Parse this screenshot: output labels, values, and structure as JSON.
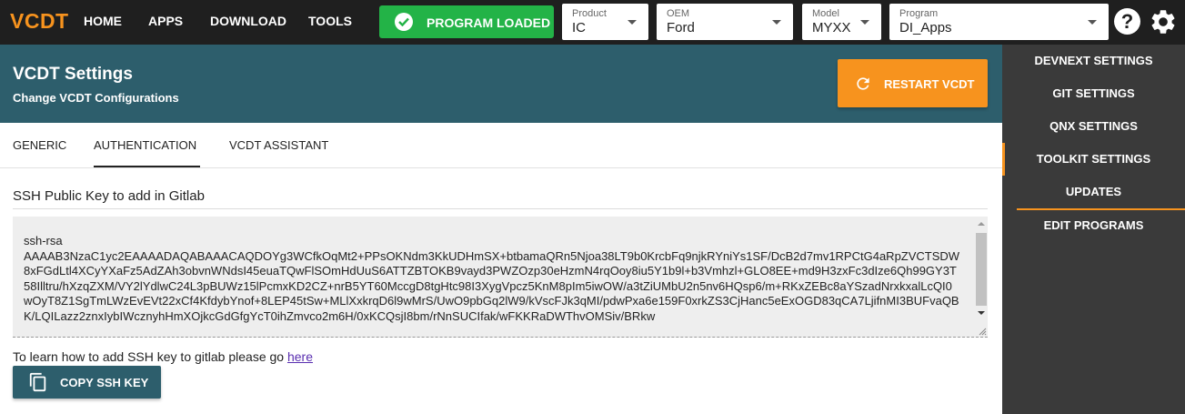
{
  "topbar": {
    "logo": "VCDT",
    "nav": [
      "HOME",
      "APPS",
      "DOWNLOAD",
      "TOOLS"
    ],
    "status_label": "PROGRAM LOADED",
    "status_color": "#23b347",
    "selectors": [
      {
        "label": "Product",
        "value": "IC"
      },
      {
        "label": "OEM",
        "value": "Ford"
      },
      {
        "label": "Model",
        "value": "MYXX"
      },
      {
        "label": "Program",
        "value": "DI_Apps"
      }
    ],
    "help_icon": "help-circle-icon",
    "settings_icon": "gear-icon"
  },
  "header": {
    "title": "VCDT Settings",
    "subtitle": "Change VCDT Configurations",
    "restart_label": "RESTART VCDT",
    "accent": "#f7931e",
    "band_color": "#2d5e6c"
  },
  "tabs": [
    {
      "label": "GENERIC",
      "active": false
    },
    {
      "label": "AUTHENTICATION",
      "active": true
    },
    {
      "label": "VCDT ASSISTANT",
      "active": false
    }
  ],
  "content": {
    "section_title": "SSH Public Key to add in Gitlab",
    "ssh_key": "ssh-rsa\nAAAAB3NzaC1yc2EAAAADAQABAAACAQDOYg3WCfkOqMt2+PPsOKNdm3KkUDHmSX+btbamaQRn5Njoa38LT9b0KrcbFq9njkRYniYs1SF/DcB2d7mv1RPCtG4aRpZVCTSDW8xFGdLtl4XCyYXaFz5AdZAh3obvnWNdsI45euaTQwFlSOmHdUuS6ATTZBTOKB9vayd3PWZOzp30eHzmN4rqOoy8iu5Y1b9l+b3Vmhzl+GLO8EE+md9H3zxFc3dIze6Qh99GY3T58Illtru/hXzqZXM/VY2lYdlwC24L3pBUWz15lPcmxKD2CZ+nrB5YT60MccgD8tgHtc98I3XygVpcz5KnM8pIm5iwOW/a3tZiUMbU2n5nv6HQsp6/m+RKxZEBc8aYSzadNrxkxalLcQI0wOyT8Z1SgTmLWzEvEVt22xCf4KfdybYnof+8LEP45tSw+MLlXxkrqD6l9wMrS/UwO9pbGq2lW9/kVscFJk3qMI/pdwPxa6e159F0xrkZS3CjHanc5eExOGD83qCA7LjifnMI3BUFvaQBK/LQILazz2znxIybIWcznyhHmXOjkcGdGfgYcT0ihZmvco2m6H/0xKCQsjI8bm/rNnSUCIfak/wFKKRaDWThvOMSiv/BRkw",
    "learn_text": "To learn how to add SSH key to gitlab please go ",
    "learn_link": "here",
    "copy_label": "COPY SSH KEY"
  },
  "sidebar": {
    "items": [
      "DEVNEXT SETTINGS",
      "GIT SETTINGS",
      "QNX SETTINGS",
      "TOOLKIT SETTINGS",
      "UPDATES",
      "EDIT PROGRAMS"
    ],
    "active_item": "TOOLKIT SETTINGS"
  }
}
